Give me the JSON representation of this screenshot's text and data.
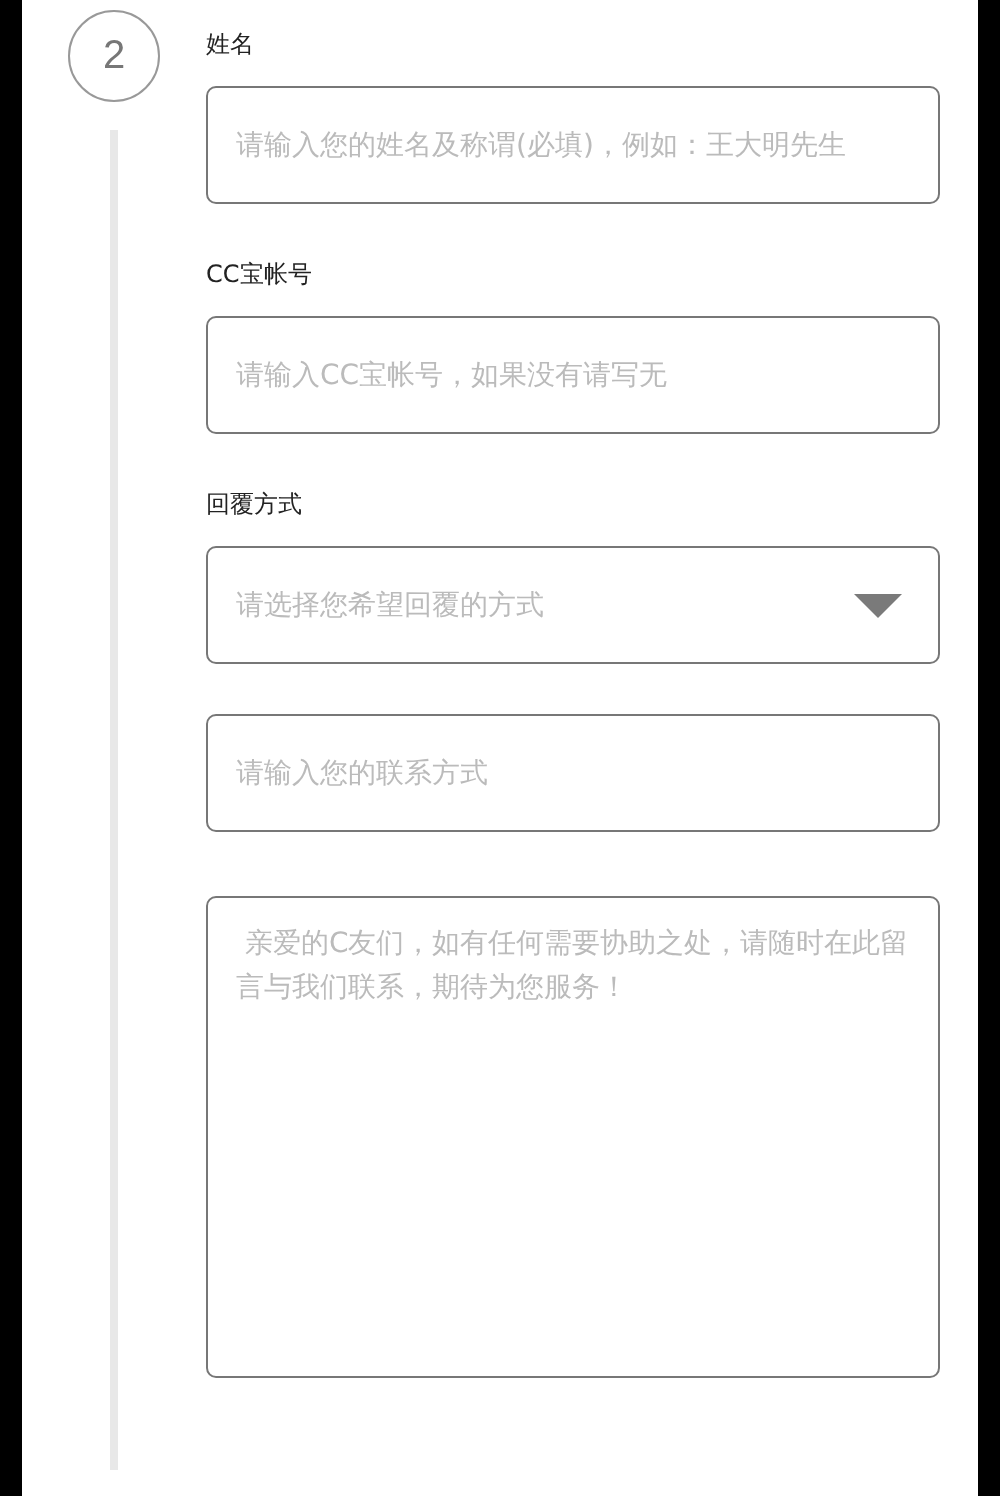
{
  "step": {
    "number": "2"
  },
  "fields": [
    {
      "kind": "input",
      "label": "姓名",
      "placeholder": "请输入您的姓名及称谓(必填)，例如：王大明先生"
    },
    {
      "kind": "input",
      "label": "CC宝帐号",
      "placeholder": "请输入CC宝帐号，如果没有请写无"
    },
    {
      "kind": "select",
      "label": "回覆方式",
      "placeholder": "请选择您希望回覆的方式"
    },
    {
      "kind": "input",
      "placeholder": "请输入您的联系方式"
    },
    {
      "kind": "textarea",
      "placeholder": " 亲爱的C友们，如有任何需要协助之处，请随时在此留言与我们联系，期待为您服务！"
    }
  ]
}
